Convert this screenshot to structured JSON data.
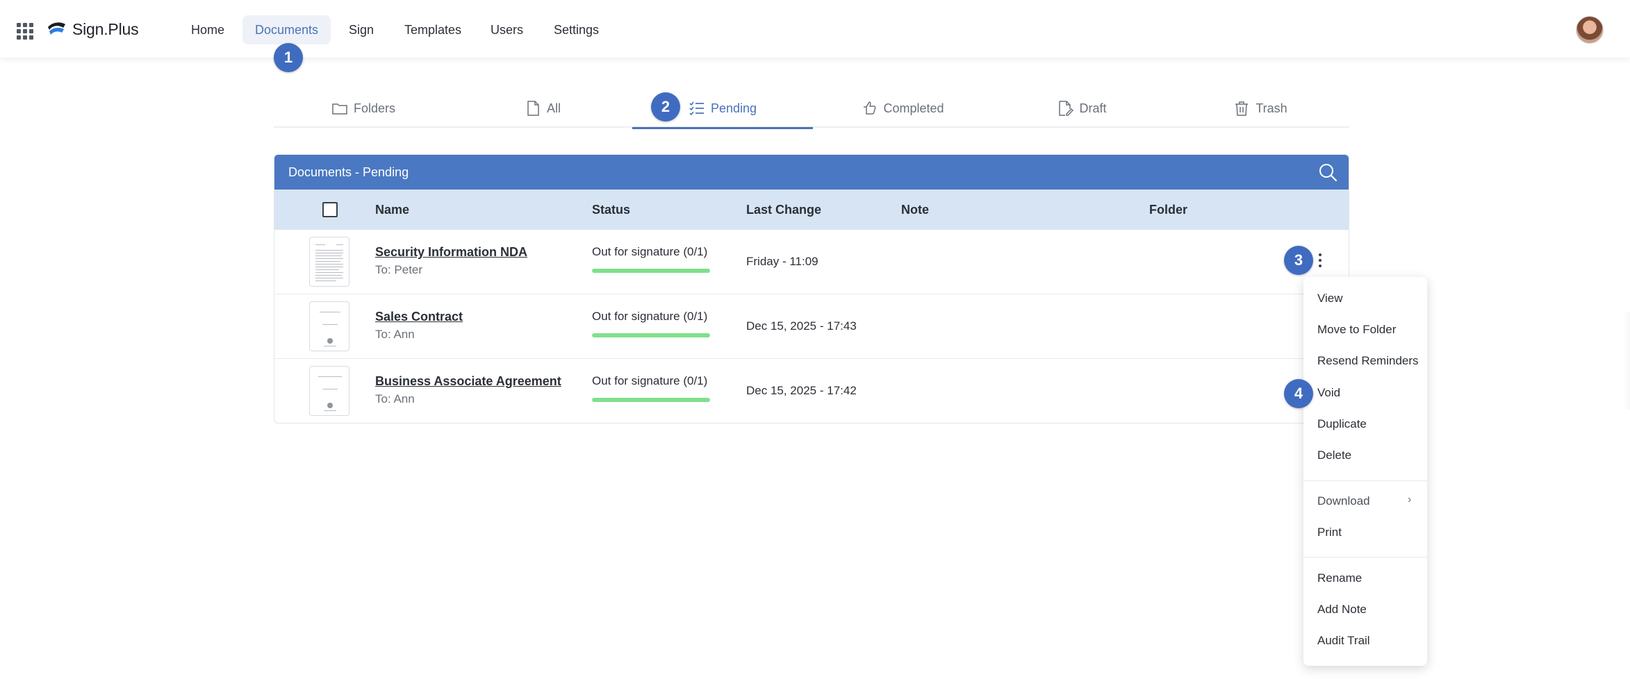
{
  "app": {
    "name": "Sign.Plus"
  },
  "nav": {
    "items": [
      {
        "label": "Home",
        "active": false
      },
      {
        "label": "Documents",
        "active": true
      },
      {
        "label": "Sign",
        "active": false
      },
      {
        "label": "Templates",
        "active": false
      },
      {
        "label": "Users",
        "active": false
      },
      {
        "label": "Settings",
        "active": false
      }
    ]
  },
  "badges": [
    "1",
    "2",
    "3",
    "4"
  ],
  "tabs": [
    {
      "label": "Folders",
      "icon": "folder-icon"
    },
    {
      "label": "All",
      "icon": "file-icon"
    },
    {
      "label": "Pending",
      "icon": "checklist-icon",
      "active": true
    },
    {
      "label": "Completed",
      "icon": "completed-icon"
    },
    {
      "label": "Draft",
      "icon": "draft-icon"
    },
    {
      "label": "Trash",
      "icon": "trash-icon"
    }
  ],
  "card": {
    "title": "Documents - Pending",
    "columns": {
      "name": "Name",
      "status": "Status",
      "last_change": "Last Change",
      "note": "Note",
      "folder": "Folder"
    }
  },
  "rows": [
    {
      "name": "Security Information NDA",
      "to": "To: Peter",
      "status": "Out for signature (0/1)",
      "progress": 1.0,
      "last_change": "Friday - 11:09"
    },
    {
      "name": "Sales Contract",
      "to": "To: Ann",
      "status": "Out for signature (0/1)",
      "progress": 1.0,
      "last_change": "Dec 15, 2025 - 17:43"
    },
    {
      "name": "Business Associate Agreement",
      "to": "To: Ann",
      "status": "Out for signature (0/1)",
      "progress": 1.0,
      "last_change": "Dec 15, 2025 - 17:42"
    }
  ],
  "menu": {
    "view": "View",
    "move": "Move to Folder",
    "resend": "Resend Reminders",
    "void": "Void",
    "duplicate": "Duplicate",
    "delete": "Delete",
    "download": "Download",
    "print": "Print",
    "rename": "Rename",
    "add_note": "Add Note",
    "audit_trail": "Audit Trail"
  },
  "colors": {
    "accent": "#4a73b8",
    "header": "#4a78c2",
    "table_head": "#d7e4f3",
    "progress": "#7fe08b",
    "badge": "#3f6cc0"
  }
}
